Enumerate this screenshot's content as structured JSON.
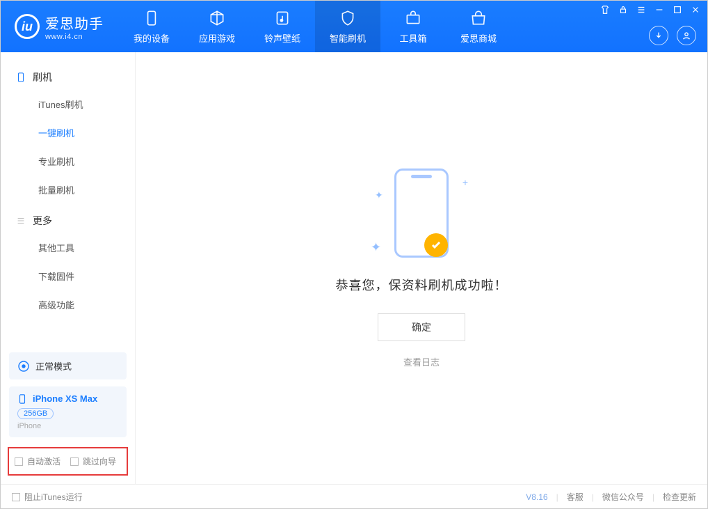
{
  "app": {
    "name": "爱思助手",
    "url": "www.i4.cn"
  },
  "nav": {
    "items": [
      {
        "label": "我的设备"
      },
      {
        "label": "应用游戏"
      },
      {
        "label": "铃声壁纸"
      },
      {
        "label": "智能刷机"
      },
      {
        "label": "工具箱"
      },
      {
        "label": "爱思商城"
      }
    ]
  },
  "sidebar": {
    "group1_title": "刷机",
    "group1_items": [
      {
        "label": "iTunes刷机"
      },
      {
        "label": "一键刷机"
      },
      {
        "label": "专业刷机"
      },
      {
        "label": "批量刷机"
      }
    ],
    "group2_title": "更多",
    "group2_items": [
      {
        "label": "其他工具"
      },
      {
        "label": "下载固件"
      },
      {
        "label": "高级功能"
      }
    ],
    "mode_label": "正常模式",
    "device": {
      "name": "iPhone XS Max",
      "capacity": "256GB",
      "type": "iPhone"
    },
    "options": {
      "auto_activate": "自动激活",
      "skip_guide": "跳过向导"
    }
  },
  "main": {
    "success": "恭喜您，保资料刷机成功啦！",
    "ok": "确定",
    "view_log": "查看日志"
  },
  "footer": {
    "block_itunes": "阻止iTunes运行",
    "version": "V8.16",
    "links": {
      "service": "客服",
      "wechat": "微信公众号",
      "update": "检查更新"
    }
  }
}
